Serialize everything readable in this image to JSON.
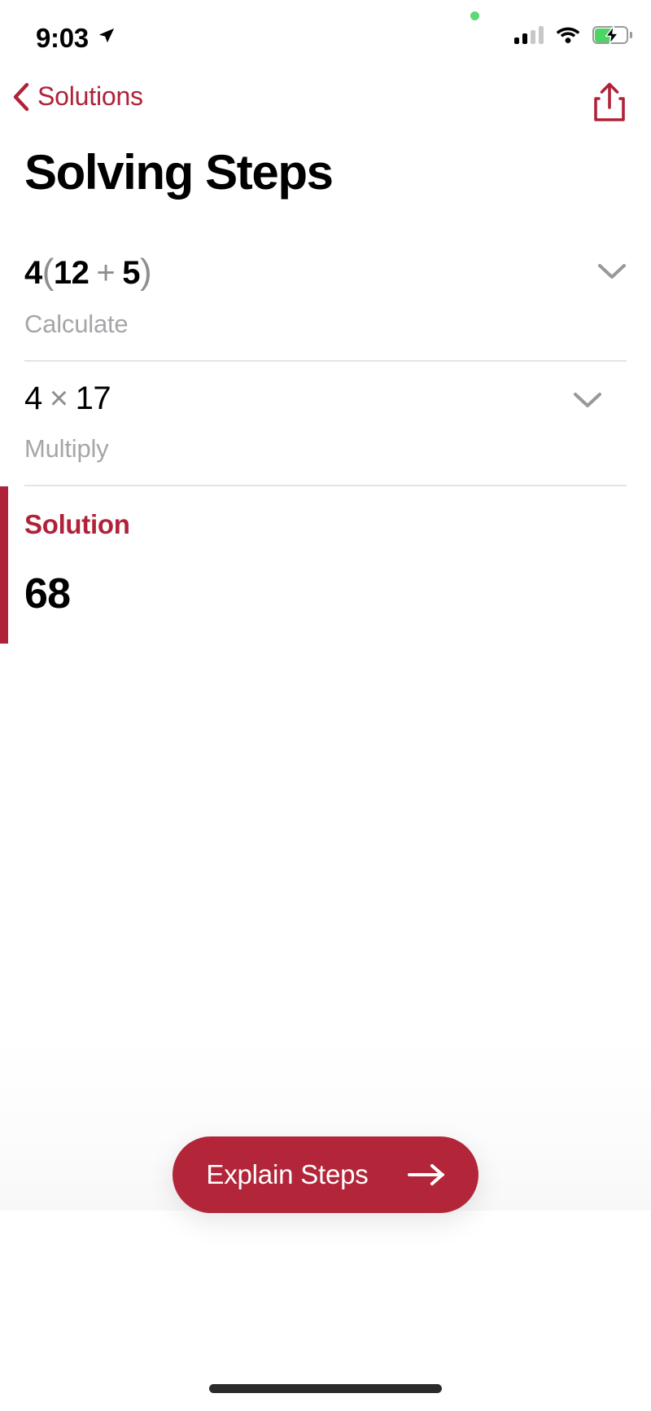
{
  "theme": {
    "accent": "#AF2239",
    "accent_button": "#B32639",
    "text_primary": "#000000",
    "text_muted": "#8E8E93",
    "caption_gray": "#A6A6AA",
    "divider": "#E4E4E6",
    "battery_green": "#4CD562",
    "privacy_dot_green": "#5CD977"
  },
  "status_bar": {
    "time": "9:03",
    "location_icon": "location-arrow-icon",
    "privacy_icon": "privacy-dot-icon",
    "cellular_icon": "cellular-signal-icon",
    "cellular_bars_filled": 2,
    "cellular_bars_total": 4,
    "wifi_icon": "wifi-icon",
    "battery_icon": "battery-charging-icon",
    "battery_charging": true,
    "battery_percent": 55
  },
  "navbar": {
    "back_label": "Solutions",
    "back_icon": "chevron-left-icon",
    "share_icon": "share-icon"
  },
  "page": {
    "title": "Solving Steps"
  },
  "steps": [
    {
      "expression_parts": [
        {
          "text": "4",
          "style": "value"
        },
        {
          "text": "(",
          "style": "paren"
        },
        {
          "text": "12",
          "style": "value"
        },
        {
          "text": "+",
          "style": "op"
        },
        {
          "text": "5",
          "style": "value"
        },
        {
          "text": ")",
          "style": "paren"
        }
      ],
      "expression_plain": "4(12 + 5)",
      "caption": "Calculate",
      "bold": true,
      "expand_icon": "chevron-down-icon",
      "expanded": false
    },
    {
      "expression_parts": [
        {
          "text": "4",
          "style": "value"
        },
        {
          "text": "×",
          "style": "op"
        },
        {
          "text": "17",
          "style": "value"
        }
      ],
      "expression_plain": "4 × 17",
      "caption": "Multiply",
      "bold": false,
      "expand_icon": "chevron-down-icon",
      "expanded": false
    }
  ],
  "solution": {
    "label": "Solution",
    "value": "68"
  },
  "cta": {
    "label": "Explain Steps",
    "icon": "arrow-right-icon"
  },
  "home_indicator": {
    "name": "home-indicator"
  }
}
